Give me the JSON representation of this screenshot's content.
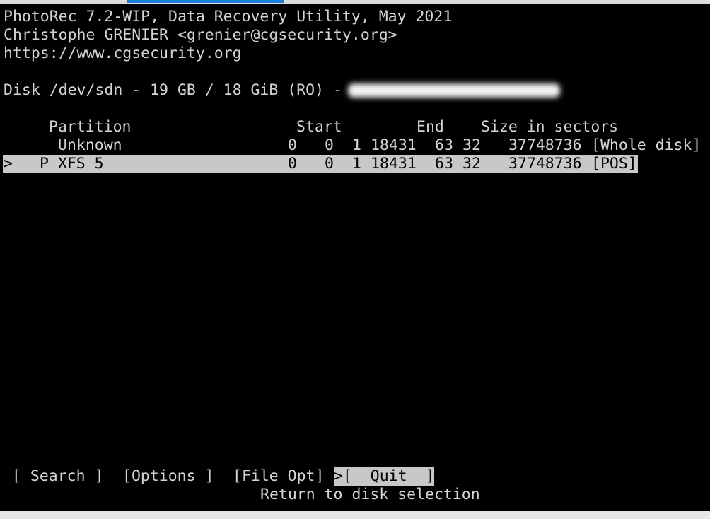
{
  "header": {
    "line1": "PhotoRec 7.2-WIP, Data Recovery Utility, May 2021",
    "line2": "Christophe GRENIER <grenier@cgsecurity.org>",
    "line3": "https://www.cgsecurity.org"
  },
  "disk": {
    "label": "Disk /dev/sdn - 19 GB / 18 GiB (RO) -"
  },
  "table": {
    "headers": {
      "partition": "Partition",
      "start": "Start",
      "end": "End",
      "size": "Size in sectors"
    },
    "rows": [
      {
        "marker": "",
        "name": "Unknown",
        "start_c": "0",
        "start_h": "0",
        "start_s": "1",
        "end_c": "18431",
        "end_h": "63",
        "end_s": "32",
        "size": "37748736",
        "tag": "[Whole disk]"
      },
      {
        "marker": ">",
        "name": "P XFS 5",
        "start_c": "0",
        "start_h": "0",
        "start_s": "1",
        "end_c": "18431",
        "end_h": "63",
        "end_s": "32",
        "size": "37748736",
        "tag": "[POS]"
      }
    ]
  },
  "menu": {
    "search": "[ Search ]",
    "options": "[Options ]",
    "file_opt": "[File Opt]",
    "quit_marker": ">",
    "quit": "[  Quit  ]",
    "hint": "Return to disk selection"
  },
  "colors": {
    "background": "#000000",
    "foreground": "#d3d3d3",
    "highlight": "#c8c8c8"
  }
}
